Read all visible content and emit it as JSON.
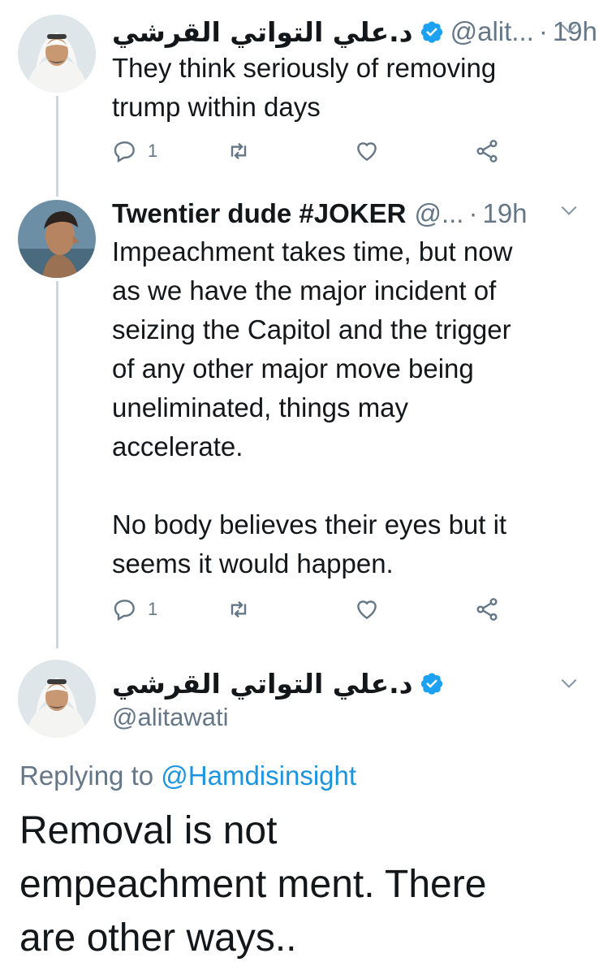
{
  "colors": {
    "accent": "#1da1f2",
    "link": "#1b95e0",
    "muted": "#657786",
    "text": "#14171a",
    "thread_line": "#ccd6dd"
  },
  "tweets": [
    {
      "display_name": "د.علي التواتي القرشي",
      "handle": "@alit...",
      "separator": "·",
      "time": "19h",
      "verified": true,
      "text": "They think seriously of removing\ntrump within days",
      "reply_count": "1",
      "icons": {
        "reply": "reply-icon",
        "retweet": "retweet-icon",
        "like": "heart-icon",
        "share": "share-icon"
      }
    },
    {
      "display_name": "Twentier dude #JOKER",
      "handle": "@...",
      "separator": "·",
      "time": "19h",
      "verified": false,
      "text": "Impeachment takes time, but now\nas we have the major incident of\nseizing the Capitol and the trigger\nof any other major move being\nuneliminated, things may\naccelerate.\n\nNo body believes their eyes but it\nseems it would happen.",
      "reply_count": "1"
    }
  ],
  "main_tweet": {
    "display_name": "د.علي التواتي القرشي",
    "handle": "@alitawati",
    "verified": true,
    "replying_prefix": "Replying to",
    "replying_handle": "@Hamdisinsight",
    "text": "Removal is not\nempeachment ment. There\nare other ways.."
  }
}
